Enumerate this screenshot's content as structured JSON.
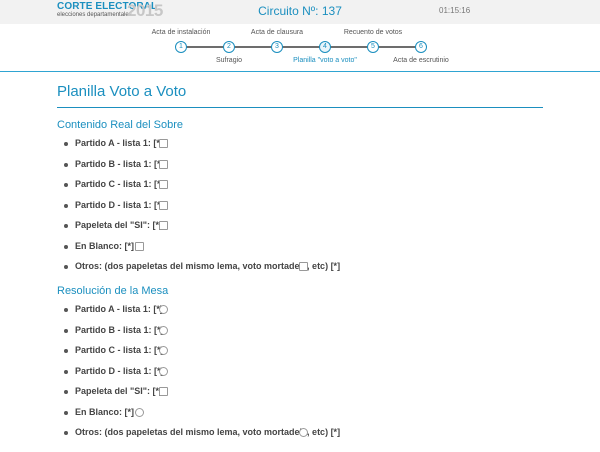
{
  "header": {
    "logo_title": "CORTE ELECTORAL",
    "logo_sub": "elecciones departamentales",
    "logo_year": "2015",
    "circuit": "Circuito Nº: 137",
    "clock": "01:15:16"
  },
  "stepper": {
    "steps": [
      {
        "number": "1",
        "label": "Acta de instalación"
      },
      {
        "number": "2",
        "label": "Sufragio"
      },
      {
        "number": "3",
        "label": "Acta de clausura"
      },
      {
        "number": "4",
        "label": "Planilla \"voto a voto\""
      },
      {
        "number": "5",
        "label": "Recuento de votos"
      },
      {
        "number": "6",
        "label": "Acta de escrutinio"
      }
    ],
    "active_step": 4
  },
  "main": {
    "title": "Planilla Voto a Voto",
    "sections": [
      {
        "title": "Contenido Real del Sobre",
        "control": "checkbox",
        "items": [
          "Partido A - lista 1: [*]",
          "Partido B - lista 1: [*]",
          "Partido C - lista 1: [*]",
          "Partido D - lista 1: [*]",
          "Papeleta del \"SI\": [*]",
          "En Blanco: [*]",
          "Otros: (dos papeletas del mismo lema, voto mortadela, etc) [*]"
        ]
      },
      {
        "title": "Resolución de la Mesa",
        "control": "radio",
        "items": [
          "Partido A - lista 1: [*]",
          "Partido B - lista 1: [*]",
          "Partido C - lista 1: [*]",
          "Partido D - lista 1: [*]",
          "Papeleta del \"SI\": [*]",
          "En Blanco: [*]",
          "Otros: (dos papeletas del mismo lema, voto mortadela, etc) [*]"
        ]
      }
    ]
  },
  "colors": {
    "accent": "#1b8fbf",
    "topbar_bg": "#f2f2f2"
  }
}
